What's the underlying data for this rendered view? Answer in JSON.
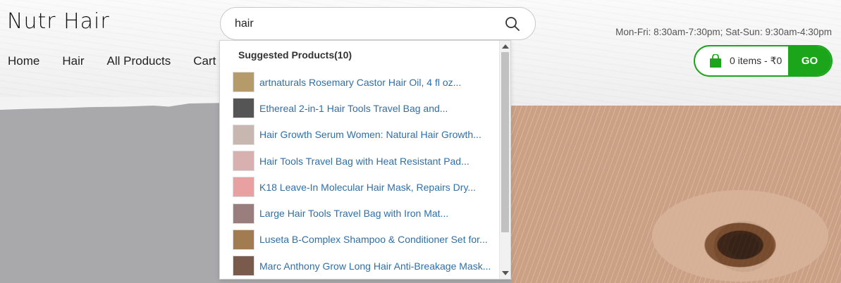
{
  "brand": {
    "logo": "Nutr Hair"
  },
  "search": {
    "value": "hair",
    "placeholder": ""
  },
  "hours": "Mon-Fri: 8:30am-7:30pm; Sat-Sun: 9:30am-4:30pm",
  "nav": {
    "items": [
      {
        "label": "Home"
      },
      {
        "label": "Hair"
      },
      {
        "label": "All Products"
      },
      {
        "label": "Cart"
      }
    ]
  },
  "cart": {
    "summary": "0 items - ₹0",
    "go_label": "GO",
    "accent": "#1aa51a"
  },
  "suggestions": {
    "title": "Suggested Products(10)",
    "items": [
      {
        "label": "artnaturals Rosemary Castor Hair Oil, 4 fl oz...",
        "thumb_color": "#b59a6a"
      },
      {
        "label": "Ethereal 2-in-1 Hair Tools Travel Bag and...",
        "thumb_color": "#555555"
      },
      {
        "label": "Hair Growth Serum Women: Natural Hair Growth...",
        "thumb_color": "#c8b7b0"
      },
      {
        "label": "Hair Tools Travel Bag with Heat Resistant Pad...",
        "thumb_color": "#d9b0b0"
      },
      {
        "label": "K18 Leave-In Molecular Hair Mask, Repairs Dry...",
        "thumb_color": "#e8a0a0"
      },
      {
        "label": "Large Hair Tools Travel Bag with Iron Mat...",
        "thumb_color": "#9a7d7d"
      },
      {
        "label": "Luseta B-Complex Shampoo & Conditioner Set for...",
        "thumb_color": "#a07c50"
      },
      {
        "label": "Marc Anthony Grow Long Hair Anti-Breakage Mask...",
        "thumb_color": "#7a5a4a"
      }
    ]
  }
}
